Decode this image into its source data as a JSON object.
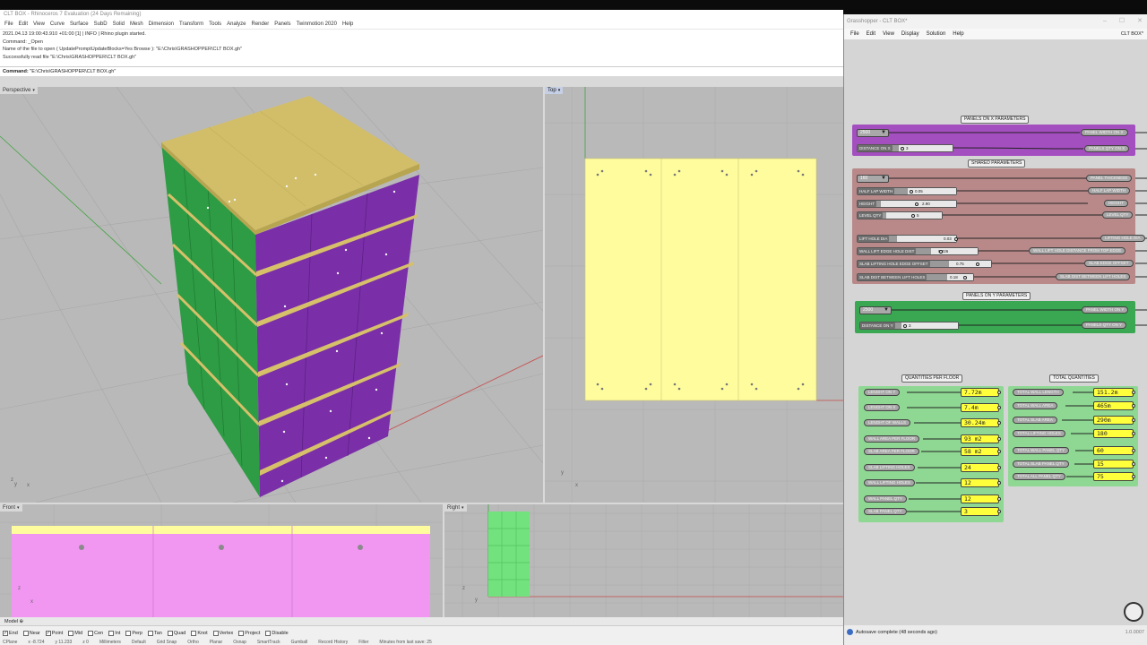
{
  "rhino": {
    "title": "CLT BOX - Rhinoceros 7 Evaluation (24 Days Remaining)",
    "menu": [
      "File",
      "Edit",
      "View",
      "Curve",
      "Surface",
      "SubD",
      "Solid",
      "Mesh",
      "Dimension",
      "Transform",
      "Tools",
      "Analyze",
      "Render",
      "Panels",
      "Twinmotion 2020",
      "Help"
    ],
    "history": [
      "2021.04.13 19:00:43.910 +01:00 [1] | INFO | Rhino plugin started.",
      "Command: _Open",
      "Name of the file to open ( UpdatePromptUpdateBlocks=Yes  Browse ): \"E:\\Chris\\GRASHOPPER\\CLT BOX.gh\"",
      "Successfully read file \"E:\\Chris\\GRASHOPPER\\CLT BOX.gh\""
    ],
    "command_label": "Command:",
    "command_value": "\"E:\\Chris\\GRASHOPPER\\CLT BOX.gh\"",
    "viewports": {
      "perspective": "Perspective",
      "top": "Top",
      "front": "Front",
      "right": "Right"
    },
    "model_tab": "Model",
    "osnaps": [
      {
        "label": "End",
        "checked": true
      },
      {
        "label": "Near",
        "checked": false
      },
      {
        "label": "Point",
        "checked": true
      },
      {
        "label": "Mid",
        "checked": false
      },
      {
        "label": "Cen",
        "checked": false
      },
      {
        "label": "Int",
        "checked": false
      },
      {
        "label": "Perp",
        "checked": false
      },
      {
        "label": "Tan",
        "checked": false
      },
      {
        "label": "Quad",
        "checked": false
      },
      {
        "label": "Knot",
        "checked": false
      },
      {
        "label": "Vertex",
        "checked": false
      },
      {
        "label": "Project",
        "checked": false
      },
      {
        "label": "Disable",
        "checked": false
      }
    ],
    "status": [
      "CPlane",
      "x -8.724",
      "y 11.233",
      "z 0",
      "Millimeters",
      "Default",
      "Grid Snap",
      "Ortho",
      "Planar",
      "Osnap",
      "SmartTrack",
      "Gumball",
      "Record History",
      "Filter",
      "Minutes from last save: 25"
    ]
  },
  "grasshopper": {
    "title": "Grasshopper - CLT BOX*",
    "menu": [
      "File",
      "Edit",
      "View",
      "Display",
      "Solution",
      "Help"
    ],
    "doc_name": "CLT BOX*",
    "autosave": "Autosave complete (48 seconds ago)",
    "version": "1.0.0007",
    "colors": {
      "purple_group": "#a44fc0",
      "rose_group": "#b9898a",
      "green_group": "#3aa852",
      "light_green_group": "#8fd893",
      "panel_yellow": "#ffff3c"
    },
    "groups": {
      "panels_x": {
        "title": "PANELS ON X PARAMETERS",
        "value_list": "2500",
        "slider": {
          "name": "DISTANCE ON X",
          "value": "3"
        },
        "outputs": [
          "PANEL WIDTH ON X",
          "PANELS QTY ON X"
        ]
      },
      "shared": {
        "title": "SHARED PARAMETERS",
        "value_list": "160",
        "sliders": [
          {
            "name": "HALF LAP WIDTH",
            "value": "0.05"
          },
          {
            "name": "HEIGHT",
            "value": "2.90"
          },
          {
            "name": "LEVEL QTY",
            "value": "5"
          },
          {
            "name": "LIFT HOLE DIA",
            "value": "0.03"
          },
          {
            "name": "WALL LIFT EDGE HOLE DIST",
            "value": "0.226"
          },
          {
            "name": "SLAB LIFTING HOLE EDGE OFFSET",
            "value": "0.75"
          },
          {
            "name": "SLAB DIST BETWEEN LIFT HOLES",
            "value": "0.18"
          }
        ],
        "outputs": [
          "PANEL THICKNESS",
          "HALF LAP WIDTH",
          "HEIGHT",
          "LEVEL QTY",
          "LIFTING HOLE DIA",
          "WALL LIFT HOLE DISTANCE FROM TOP EDGE",
          "SLAB EDGE OFFSET",
          "SLAB DIST BETWEEN LIFT HOLES"
        ]
      },
      "panels_y": {
        "title": "PANELS ON Y PARAMETERS",
        "value_list": "2500",
        "slider": {
          "name": "DISTANCE ON Y",
          "value": "3"
        },
        "outputs": [
          "PANEL WIDTH ON Y",
          "PANELS QTY ON Y"
        ]
      },
      "quantities_floor": {
        "title": "QUANTITIES PER FLOOR",
        "rows": [
          {
            "name": "LENGHT ON Y",
            "value": "7.72m"
          },
          {
            "name": "LENGHT ON X",
            "value": "7.4m"
          },
          {
            "name": "LENGHT OF WALLS",
            "value": "30.24m"
          },
          {
            "name": "WALL AREA PER FLOOR",
            "value": "93 m2"
          },
          {
            "name": "SLAB AREA PER FLOOR",
            "value": "58 m2"
          },
          {
            "name": "SLAB LIFTING HOLES",
            "value": "24"
          },
          {
            "name": "WALL LIFTING HOLES",
            "value": "12"
          },
          {
            "name": "WALL PANEL QTY",
            "value": "12"
          },
          {
            "name": "SLAB PANEL QTY",
            "value": "3"
          }
        ]
      },
      "total_quantities": {
        "title": "TOTAL QUANTITIES",
        "rows": [
          {
            "name": "TOTAL WALL LENGTH",
            "value": "151.2m"
          },
          {
            "name": "TOTAL WALL AREA",
            "value": "465m"
          },
          {
            "name": "TOTAL SLAB AREA",
            "value": "290m"
          },
          {
            "name": "TOTAL LIFTING HOLES",
            "value": "180"
          },
          {
            "name": "TOTAL WALL PANEL QTY",
            "value": "60"
          },
          {
            "name": "TOTAL SLAB PANEL QTY",
            "value": "15"
          },
          {
            "name": "TOTAL ALL PANEL QTY",
            "value": "75"
          }
        ]
      }
    }
  }
}
